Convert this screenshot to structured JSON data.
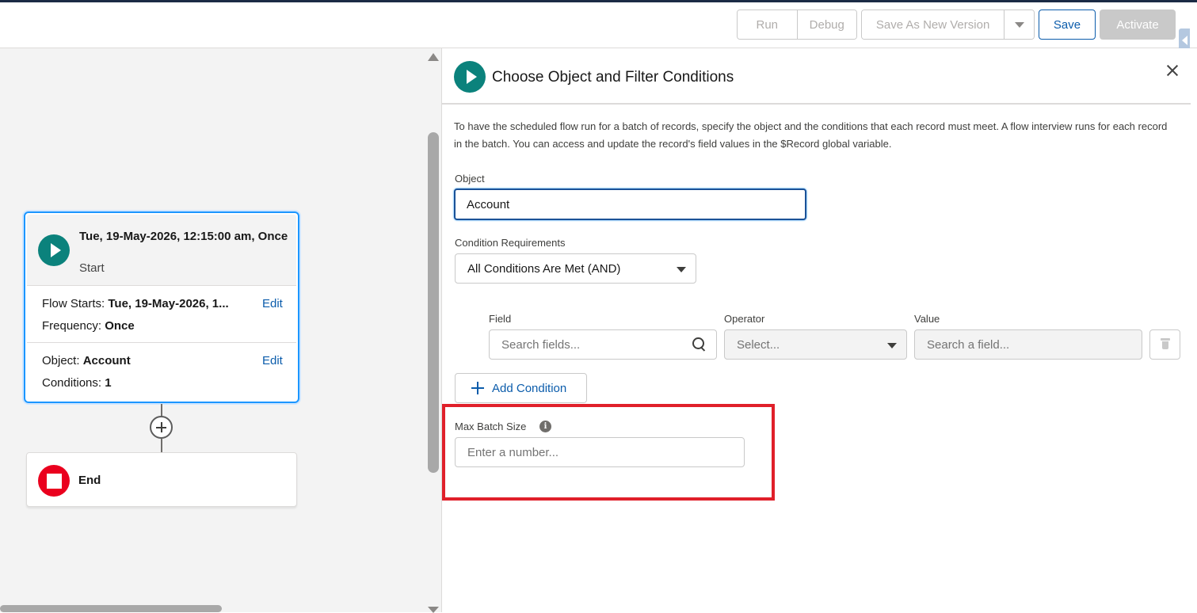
{
  "toolbar": {
    "run_label": "Run",
    "debug_label": "Debug",
    "save_as_label": "Save As New Version",
    "save_label": "Save",
    "activate_label": "Activate"
  },
  "canvas": {
    "start": {
      "title": "Tue, 19-May-2026, 12:15:00 am, Once",
      "subtitle": "Start",
      "flow_starts_label": "Flow Starts:",
      "flow_starts_value": "Tue, 19-May-2026, 1...",
      "frequency_label": "Frequency:",
      "frequency_value": "Once",
      "object_label": "Object:",
      "object_value": "Account",
      "conditions_label": "Conditions:",
      "conditions_value": "1",
      "edit_label": "Edit"
    },
    "end": {
      "label": "End"
    }
  },
  "panel": {
    "title": "Choose Object and Filter Conditions",
    "description": "To have the scheduled flow run for a batch of records, specify the object and the conditions that each record must meet. A flow interview runs for each record in the batch. You can access and update the record's field values in the $Record global variable.",
    "object_label": "Object",
    "object_value": "Account",
    "condition_req_label": "Condition Requirements",
    "condition_req_value": "All Conditions Are Met (AND)",
    "field_label": "Field",
    "field_placeholder": "Search fields...",
    "operator_label": "Operator",
    "operator_placeholder": "Select...",
    "value_label": "Value",
    "value_placeholder": "Search a field...",
    "add_condition_label": "Add Condition",
    "max_batch_label": "Max Batch Size",
    "max_batch_placeholder": "Enter a number...",
    "info_glyph": "i"
  },
  "colors": {
    "brand_blue": "#0b5cab",
    "start_teal": "#0b827c",
    "end_red": "#ea001e",
    "highlight_red": "#e0202a"
  }
}
